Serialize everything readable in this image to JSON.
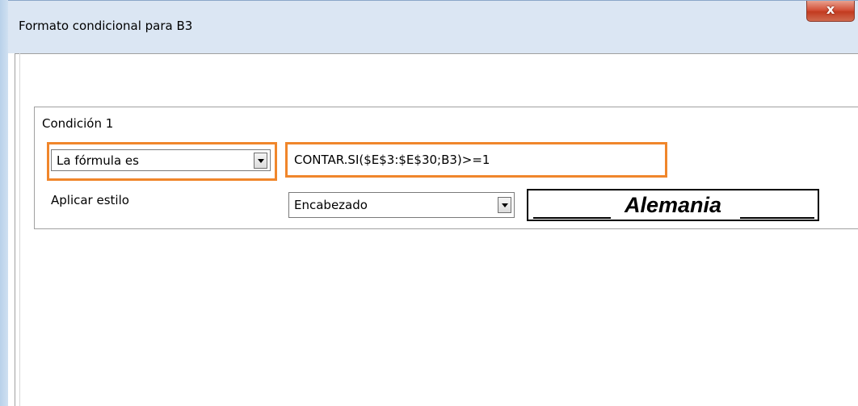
{
  "window": {
    "title": "Formato condicional para B3",
    "close_glyph": "x"
  },
  "condition": {
    "title": "Condición 1",
    "type_combo": {
      "selected": "La fórmula es"
    },
    "formula_value": "CONTAR.SI($E$3:$E$30;B3)>=1",
    "apply_style_label": "Aplicar estilo",
    "style_combo": {
      "selected": "Encabezado"
    },
    "preview_text": "Alemania"
  },
  "colors": {
    "highlight": "#f0862b",
    "titlebar": "#dbe6f3",
    "close_button": "#c23b20"
  },
  "icons": {
    "dropdown": "chevron-down-icon",
    "close": "close-icon"
  }
}
